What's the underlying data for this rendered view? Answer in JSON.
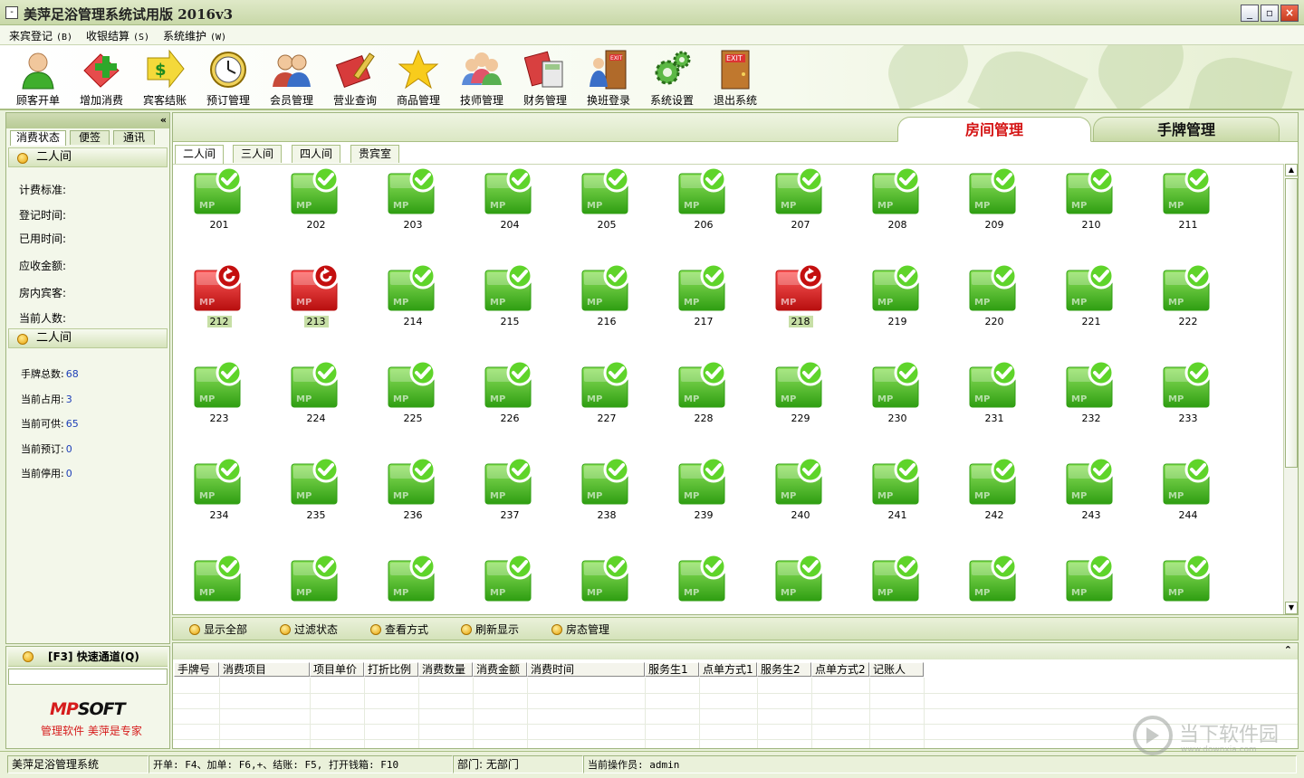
{
  "window": {
    "title": "美萍足浴管理系统试用版 2016v3"
  },
  "menu": [
    {
      "label": "来宾登记",
      "key": "(B)"
    },
    {
      "label": "收银结算",
      "key": "(S)"
    },
    {
      "label": "系统维护",
      "key": "(W)"
    }
  ],
  "toolbar": [
    {
      "label": "顾客开单",
      "icon": "customer-icon"
    },
    {
      "label": "增加消费",
      "icon": "add-consumption-icon"
    },
    {
      "label": "宾客结账",
      "icon": "checkout-icon"
    },
    {
      "label": "预订管理",
      "icon": "clock-icon"
    },
    {
      "label": "会员管理",
      "icon": "members-icon"
    },
    {
      "label": "营业查询",
      "icon": "query-icon"
    },
    {
      "label": "商品管理",
      "icon": "star-icon"
    },
    {
      "label": "技师管理",
      "icon": "technicians-icon"
    },
    {
      "label": "财务管理",
      "icon": "calculator-icon"
    },
    {
      "label": "换班登录",
      "icon": "shift-login-icon"
    },
    {
      "label": "系统设置",
      "icon": "gears-icon"
    },
    {
      "label": "退出系统",
      "icon": "exit-icon"
    }
  ],
  "left": {
    "tabs": [
      "消费状态",
      "便签",
      "通讯"
    ],
    "section1_title": "二人间",
    "fields": [
      "计费标准:",
      "登记时间:",
      "已用时间:",
      "应收金额:",
      "房内宾客:",
      "当前人数:"
    ],
    "section2_title": "二人间",
    "stats": [
      {
        "label": "手牌总数:",
        "value": "68"
      },
      {
        "label": "当前占用:",
        "value": "3"
      },
      {
        "label": "当前可供:",
        "value": "65"
      },
      {
        "label": "当前预订:",
        "value": "0"
      },
      {
        "label": "当前停用:",
        "value": "0"
      }
    ],
    "quick_title": "[F3] 快速通道(Q)",
    "logo_mp": "MP",
    "logo_soft": "SOFT",
    "slogan": "管理软件  美萍是专家"
  },
  "main": {
    "tabs": [
      "房间管理",
      "手牌管理"
    ],
    "subtabs": [
      "二人间",
      "三人间",
      "四人间",
      "贵宾室"
    ],
    "rooms": [
      {
        "num": "201",
        "status": "free"
      },
      {
        "num": "202",
        "status": "free"
      },
      {
        "num": "203",
        "status": "free"
      },
      {
        "num": "204",
        "status": "free"
      },
      {
        "num": "205",
        "status": "free"
      },
      {
        "num": "206",
        "status": "free"
      },
      {
        "num": "207",
        "status": "free"
      },
      {
        "num": "208",
        "status": "free"
      },
      {
        "num": "209",
        "status": "free"
      },
      {
        "num": "210",
        "status": "free"
      },
      {
        "num": "211",
        "status": "free"
      },
      {
        "num": "212",
        "status": "busy"
      },
      {
        "num": "213",
        "status": "busy"
      },
      {
        "num": "214",
        "status": "free"
      },
      {
        "num": "215",
        "status": "free"
      },
      {
        "num": "216",
        "status": "free"
      },
      {
        "num": "217",
        "status": "free"
      },
      {
        "num": "218",
        "status": "busy"
      },
      {
        "num": "219",
        "status": "free"
      },
      {
        "num": "220",
        "status": "free"
      },
      {
        "num": "221",
        "status": "free"
      },
      {
        "num": "222",
        "status": "free"
      },
      {
        "num": "223",
        "status": "free"
      },
      {
        "num": "224",
        "status": "free"
      },
      {
        "num": "225",
        "status": "free"
      },
      {
        "num": "226",
        "status": "free"
      },
      {
        "num": "227",
        "status": "free"
      },
      {
        "num": "228",
        "status": "free"
      },
      {
        "num": "229",
        "status": "free"
      },
      {
        "num": "230",
        "status": "free"
      },
      {
        "num": "231",
        "status": "free"
      },
      {
        "num": "232",
        "status": "free"
      },
      {
        "num": "233",
        "status": "free"
      },
      {
        "num": "234",
        "status": "free"
      },
      {
        "num": "235",
        "status": "free"
      },
      {
        "num": "236",
        "status": "free"
      },
      {
        "num": "237",
        "status": "free"
      },
      {
        "num": "238",
        "status": "free"
      },
      {
        "num": "239",
        "status": "free"
      },
      {
        "num": "240",
        "status": "free"
      },
      {
        "num": "241",
        "status": "free"
      },
      {
        "num": "242",
        "status": "free"
      },
      {
        "num": "243",
        "status": "free"
      },
      {
        "num": "244",
        "status": "free"
      },
      {
        "num": "",
        "status": "free"
      },
      {
        "num": "",
        "status": "free"
      },
      {
        "num": "",
        "status": "free"
      },
      {
        "num": "",
        "status": "free"
      },
      {
        "num": "",
        "status": "free"
      },
      {
        "num": "",
        "status": "free"
      },
      {
        "num": "",
        "status": "free"
      },
      {
        "num": "",
        "status": "free"
      },
      {
        "num": "",
        "status": "free"
      },
      {
        "num": "",
        "status": "free"
      },
      {
        "num": "",
        "status": "free"
      }
    ]
  },
  "actions": [
    "显示全部",
    "过滤状态",
    "查看方式",
    "刷新显示",
    "房态管理"
  ],
  "table": {
    "columns": [
      "手牌号",
      "消费项目",
      "项目单价",
      "打折比例",
      "消费数量",
      "消费金额",
      "消费时间",
      "服务生1",
      "点单方式1",
      "服务生2",
      "点单方式2",
      "记账人"
    ]
  },
  "status": {
    "app": "美萍足浴管理系统",
    "shortcuts": "开单: F4、加单: F6,+、结账: F5, 打开钱箱: F10",
    "dept": "部门: 无部门",
    "operator": "当前操作员: admin"
  },
  "watermark": {
    "text": "当下软件园",
    "sub": "www.downxia.com"
  },
  "colors": {
    "free": "#2fae12",
    "busy": "#d41313",
    "accent": "#a9bf83"
  }
}
